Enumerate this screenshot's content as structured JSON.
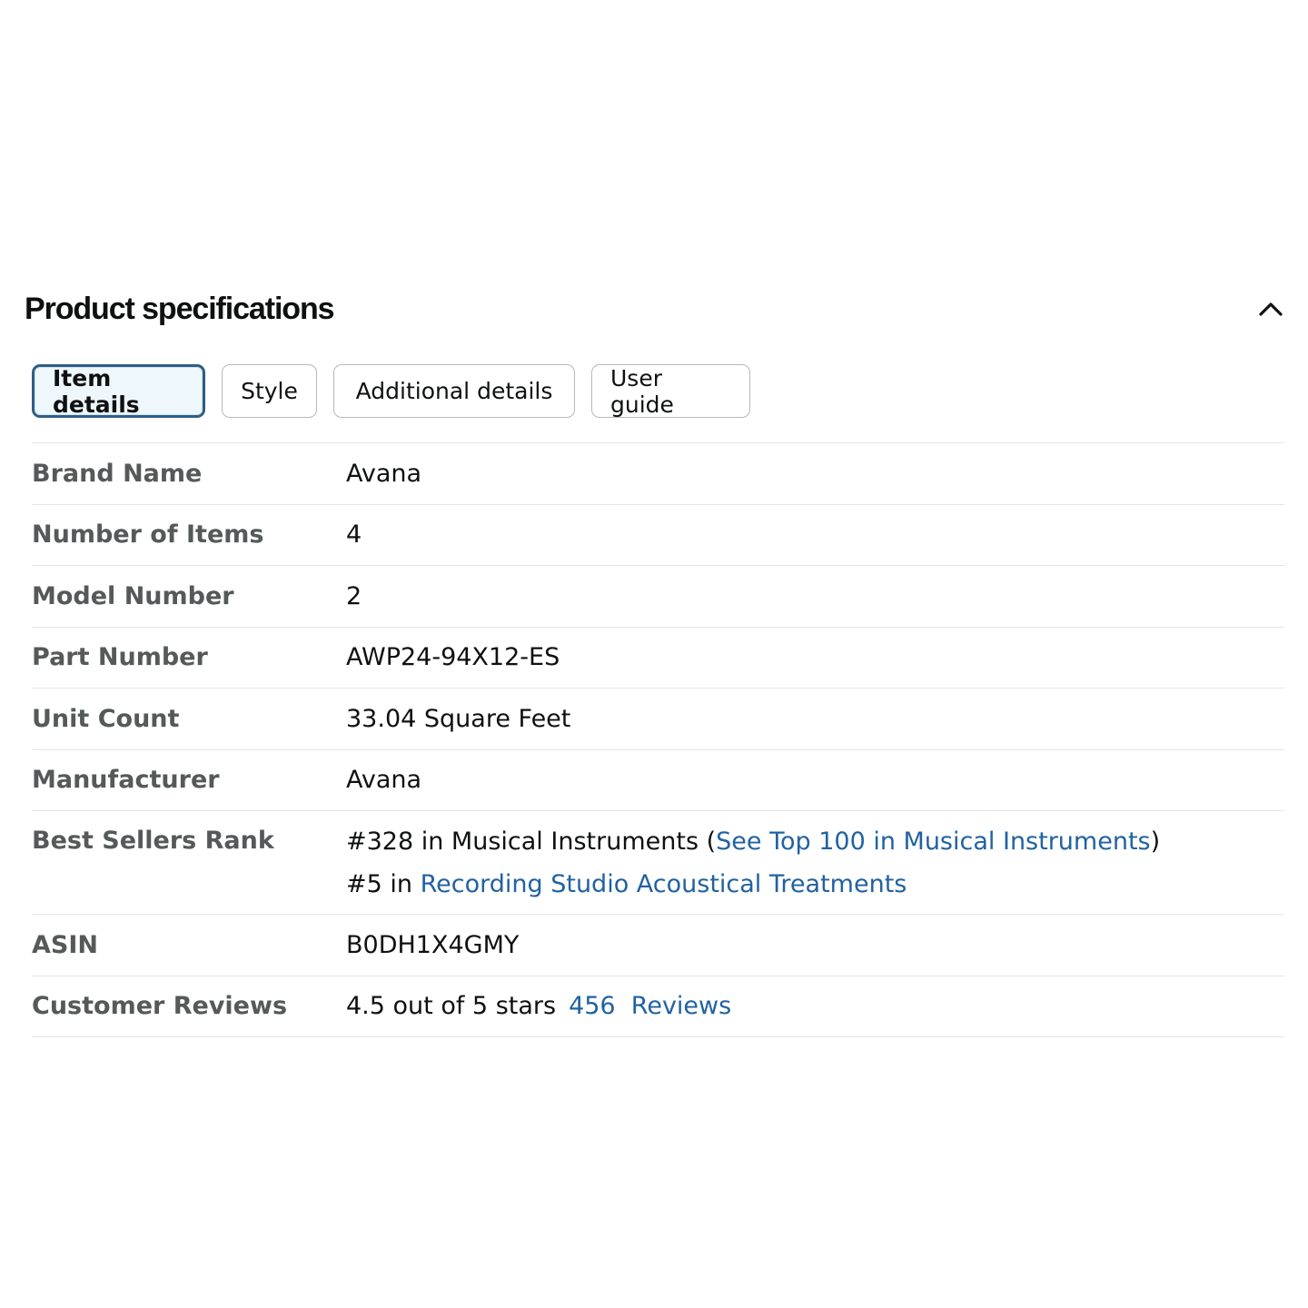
{
  "header": {
    "title": "Product specifications"
  },
  "tabs": [
    {
      "label": "Item details",
      "active": true
    },
    {
      "label": "Style",
      "active": false
    },
    {
      "label": "Additional details",
      "active": false
    },
    {
      "label": "User guide",
      "active": false
    }
  ],
  "specs": {
    "brand": {
      "label": "Brand Name",
      "value": "Avana"
    },
    "items": {
      "label": "Number of Items",
      "value": "4"
    },
    "model": {
      "label": "Model Number",
      "value": "2"
    },
    "part": {
      "label": "Part Number",
      "value": "AWP24-94X12-ES"
    },
    "unit": {
      "label": "Unit Count",
      "value": "33.04 Square Feet"
    },
    "manufacturer": {
      "label": "Manufacturer",
      "value": "Avana"
    },
    "rank": {
      "label": "Best Sellers Rank",
      "line1_prefix": "#328 in Musical Instruments (",
      "line1_link": "See Top 100 in Musical Instruments",
      "line1_suffix": ")",
      "line2_prefix": "#5 in ",
      "line2_link": "Recording Studio Acoustical Treatments"
    },
    "asin": {
      "label": "ASIN",
      "value": "B0DH1X4GMY"
    },
    "reviews": {
      "label": "Customer Reviews",
      "rating_text": "4.5 out of 5 stars",
      "count": "456",
      "count_suffix": "Reviews"
    }
  },
  "icons": {
    "collapse": "chevron-up-icon"
  },
  "colors": {
    "link": "#2162a1",
    "label": "#565959",
    "active_tab_border": "#2e5f86",
    "active_tab_bg": "#eef7fc"
  }
}
